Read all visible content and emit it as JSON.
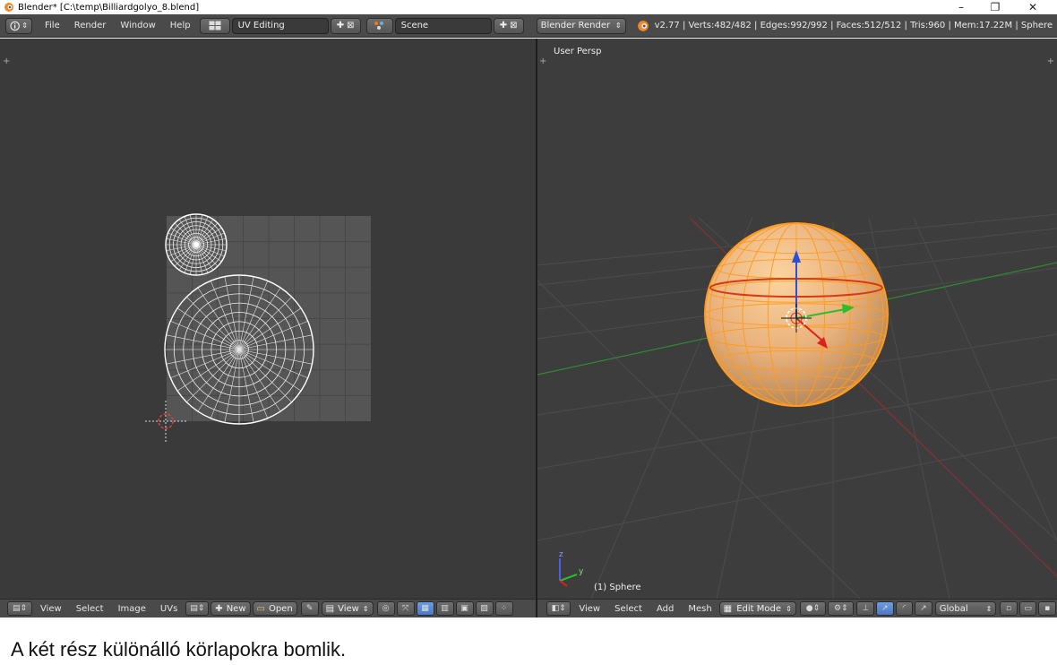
{
  "window": {
    "title": "Blender* [C:\\temp\\Billiardgolyo_8.blend]",
    "minimize": "–",
    "restore": "❐",
    "close": "✕"
  },
  "infobar": {
    "menus": [
      "File",
      "Render",
      "Window",
      "Help"
    ],
    "layout": "UV Editing",
    "scene": "Scene",
    "engine": "Blender Render",
    "stats": "v2.77 | Verts:482/482 | Edges:992/992 | Faces:512/512 | Tris:960 | Mem:17.22M | Sphere"
  },
  "uv_editor": {
    "footer": {
      "menus": [
        "View",
        "Select",
        "Image",
        "UVs"
      ],
      "new_label": "New",
      "open_label": "Open",
      "view_label": "View"
    }
  },
  "viewport": {
    "persp_label": "User Persp",
    "object_label": "(1) Sphere",
    "footer": {
      "menus": [
        "View",
        "Select",
        "Add",
        "Mesh"
      ],
      "mode": "Edit Mode",
      "orientation": "Global"
    },
    "axis_labels": {
      "z": "z",
      "y": "y"
    }
  },
  "caption": "A két rész különálló körlapokra bomlik.",
  "colors": {
    "panel": "#4a4a4a",
    "uv_bg": "#3a3a3a",
    "viewport_bg": "#3d3d3d",
    "sphere": "#f5a93c",
    "selection": "#ffb347"
  }
}
